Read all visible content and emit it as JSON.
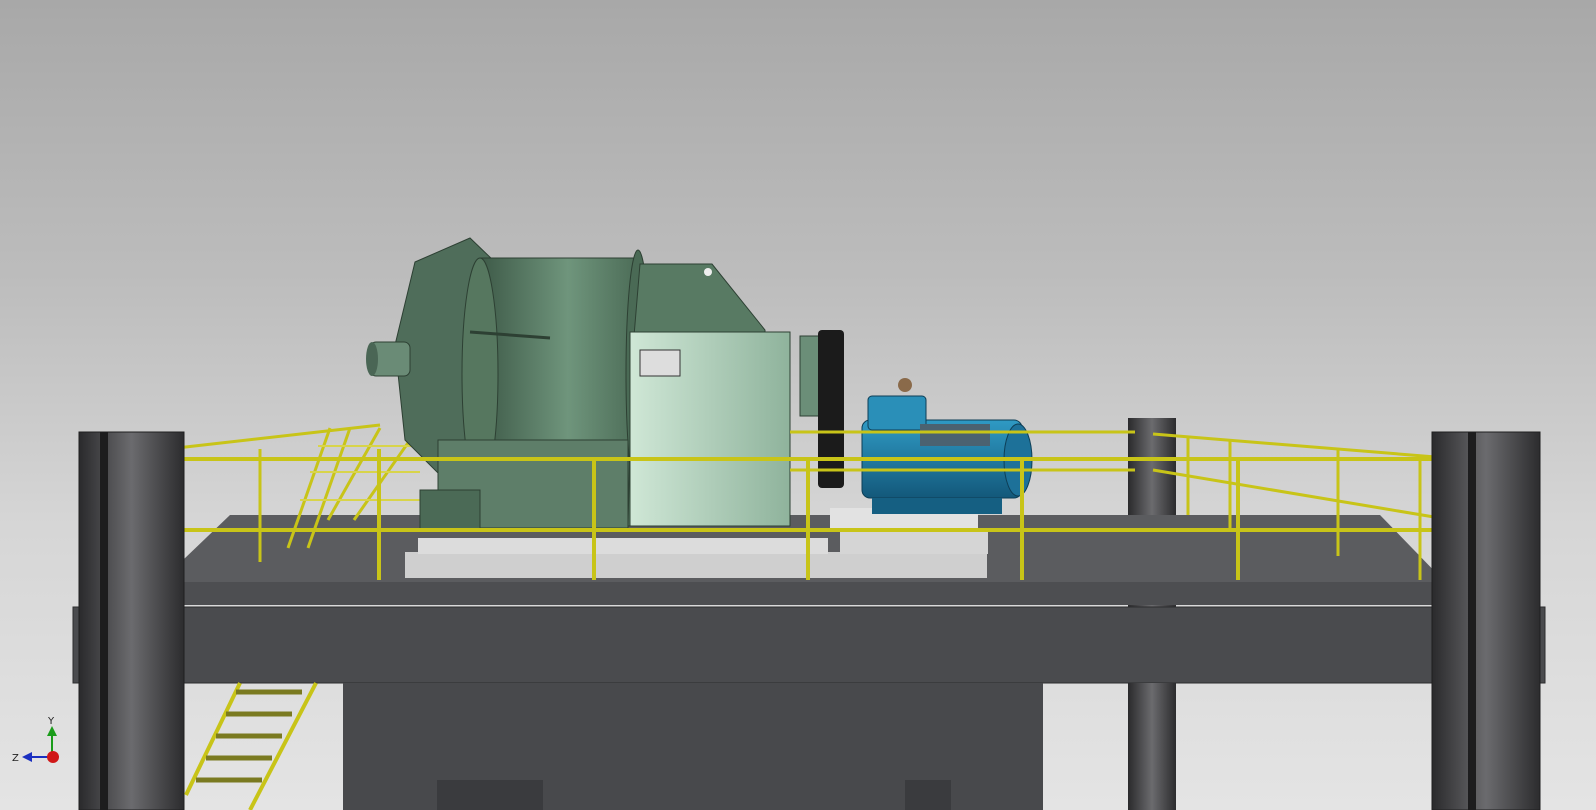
{
  "view": {
    "background_top": "#a8a8a8",
    "background_bottom": "#e4e4e4"
  },
  "scene": {
    "platform_color": "#4a4b4e",
    "column_color": "#3c3c3e",
    "railing_color": "#c8c418",
    "stair_color": "#c8c418",
    "mill_color": "#5a7a66",
    "mill_light_color": "#a9c9b3",
    "motor_color": "#1f7ea8",
    "belt_color": "#1b1b1b"
  },
  "triad": {
    "y_label": "Y",
    "z_label": "Z",
    "y_color": "#1a9c1a",
    "z_color": "#1a2fc0",
    "x_color": "#d01818"
  }
}
